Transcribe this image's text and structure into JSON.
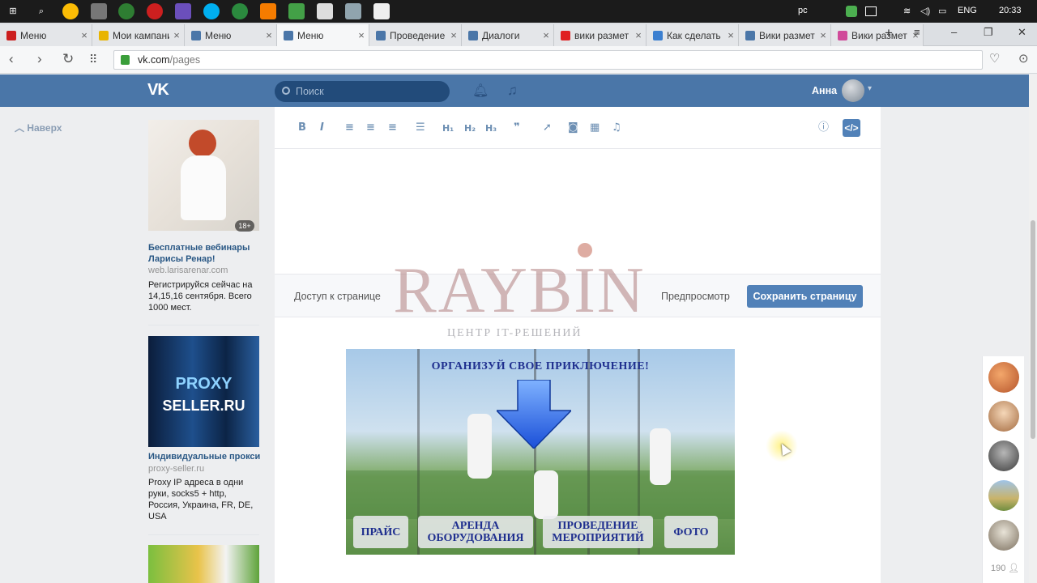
{
  "taskbar": {
    "lang_indicator": "pc",
    "keyboard": "ENG",
    "time": "20:33"
  },
  "tabs": [
    {
      "label": "Меню",
      "icon": "opera-icon",
      "color": "#cc1f1f"
    },
    {
      "label": "Мои кампании",
      "icon": "notes-icon",
      "color": "#e8b400"
    },
    {
      "label": "Меню",
      "icon": "vk-icon",
      "color": "#4a76a8"
    },
    {
      "label": "Меню",
      "icon": "vk-icon",
      "color": "#4a76a8",
      "active": true
    },
    {
      "label": "Проведение",
      "icon": "vk-icon",
      "color": "#4a76a8"
    },
    {
      "label": "Диалоги",
      "icon": "chat-icon",
      "color": "#4a76a8"
    },
    {
      "label": "вики размет",
      "icon": "yandex-icon",
      "color": "#e02020"
    },
    {
      "label": "Как сделать",
      "icon": "puzzle-icon",
      "color": "#3b7fd0"
    },
    {
      "label": "Вики размет",
      "icon": "vk-icon",
      "color": "#4a76a8"
    },
    {
      "label": "Вики размет",
      "icon": "colorful-icon",
      "color": "#d04a9a"
    }
  ],
  "address": {
    "host": "vk.com",
    "path": "/pages"
  },
  "vk": {
    "logo": "VK",
    "search_placeholder": "Поиск",
    "user_name": "Анна",
    "back_to_top": "Наверх"
  },
  "ads": [
    {
      "title": "Бесплатные вебинары Ларисы Ренар!",
      "domain": "web.larisarenar.com",
      "desc": "Регистрируйся сейчас на 14,15,16 сентября. Всего 1000 мест.",
      "badge": "18+"
    },
    {
      "title": "Индивидуальные прокси",
      "domain": "proxy-seller.ru",
      "desc": "Proxy IP адреса в одни руки, socks5 + http, Россия, Украина, FR, DE, USA",
      "image_text": [
        "PROXY",
        "SELLER.RU"
      ]
    }
  ],
  "editor": {
    "access_label": "Доступ к странице",
    "preview_label": "Предпросмотр",
    "save_label": "Сохранить страницу",
    "toolbar": {
      "bold": "B",
      "italic": "I",
      "h1": "H₁",
      "h2": "H₂",
      "h3": "H₃",
      "quote": "❞",
      "code": "</>"
    }
  },
  "watermark": {
    "brand": "RAYBIN",
    "subtitle": "ЦЕНТР IT-РЕШЕНИЙ"
  },
  "banner": {
    "title": "ОРГАНИЗУЙ СВОЕ ПРИКЛЮЧЕНИЕ!",
    "buttons": [
      {
        "line1": "ПРАЙС",
        "line2": ""
      },
      {
        "line1": "АРЕНДА",
        "line2": "ОБОРУДОВАНИЯ"
      },
      {
        "line1": "ПРОВЕДЕНИЕ",
        "line2": "МЕРОПРИЯТИЙ"
      },
      {
        "line1": "ФОТО",
        "line2": ""
      }
    ]
  },
  "friends_count": "190"
}
